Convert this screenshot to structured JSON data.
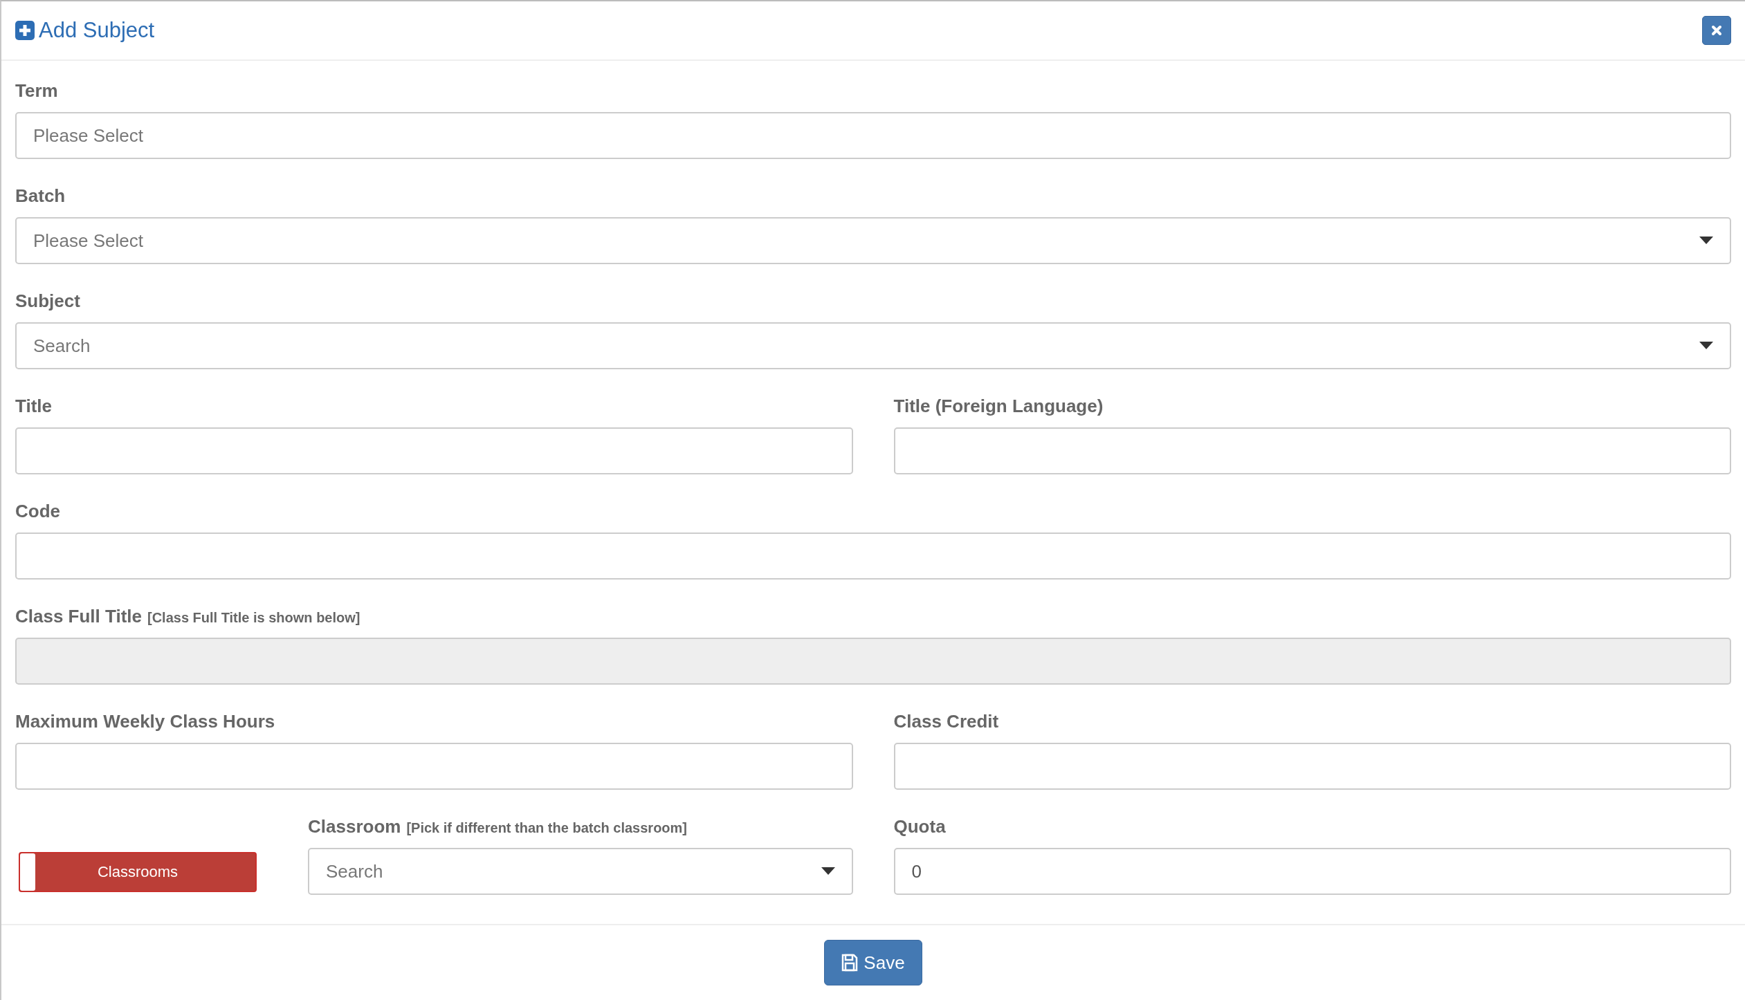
{
  "dialog": {
    "title": "Add Subject"
  },
  "rows": [
    [
      {
        "kind": "input",
        "label": "Term",
        "placeholder": "Please Select"
      }
    ],
    [
      {
        "kind": "dropdown",
        "label": "Batch",
        "placeholder": "Please Select"
      }
    ],
    [
      {
        "kind": "dropdown",
        "label": "Subject",
        "placeholder": "Search"
      }
    ],
    [
      {
        "kind": "input",
        "label": "Title"
      },
      {
        "kind": "input",
        "label": "Title (Foreign Language)"
      }
    ],
    [
      {
        "kind": "input",
        "label": "Code"
      }
    ],
    [
      {
        "kind": "input",
        "label": "Class Full Title",
        "note": "[Class Full Title is shown below]",
        "disabled": true
      }
    ],
    [
      {
        "kind": "input",
        "label": "Maximum Weekly Class Hours"
      },
      {
        "kind": "input",
        "label": "Class Credit"
      }
    ],
    [
      {
        "kind": "switch",
        "label": "Classrooms",
        "on": false
      },
      {
        "kind": "dropdown",
        "label": "Classroom",
        "note": "[Pick if different than the batch classroom]",
        "placeholder": "Search"
      },
      {
        "kind": "input",
        "label": "Quota",
        "value": "0"
      }
    ]
  ],
  "buttons": [
    {
      "label": "Save"
    }
  ]
}
